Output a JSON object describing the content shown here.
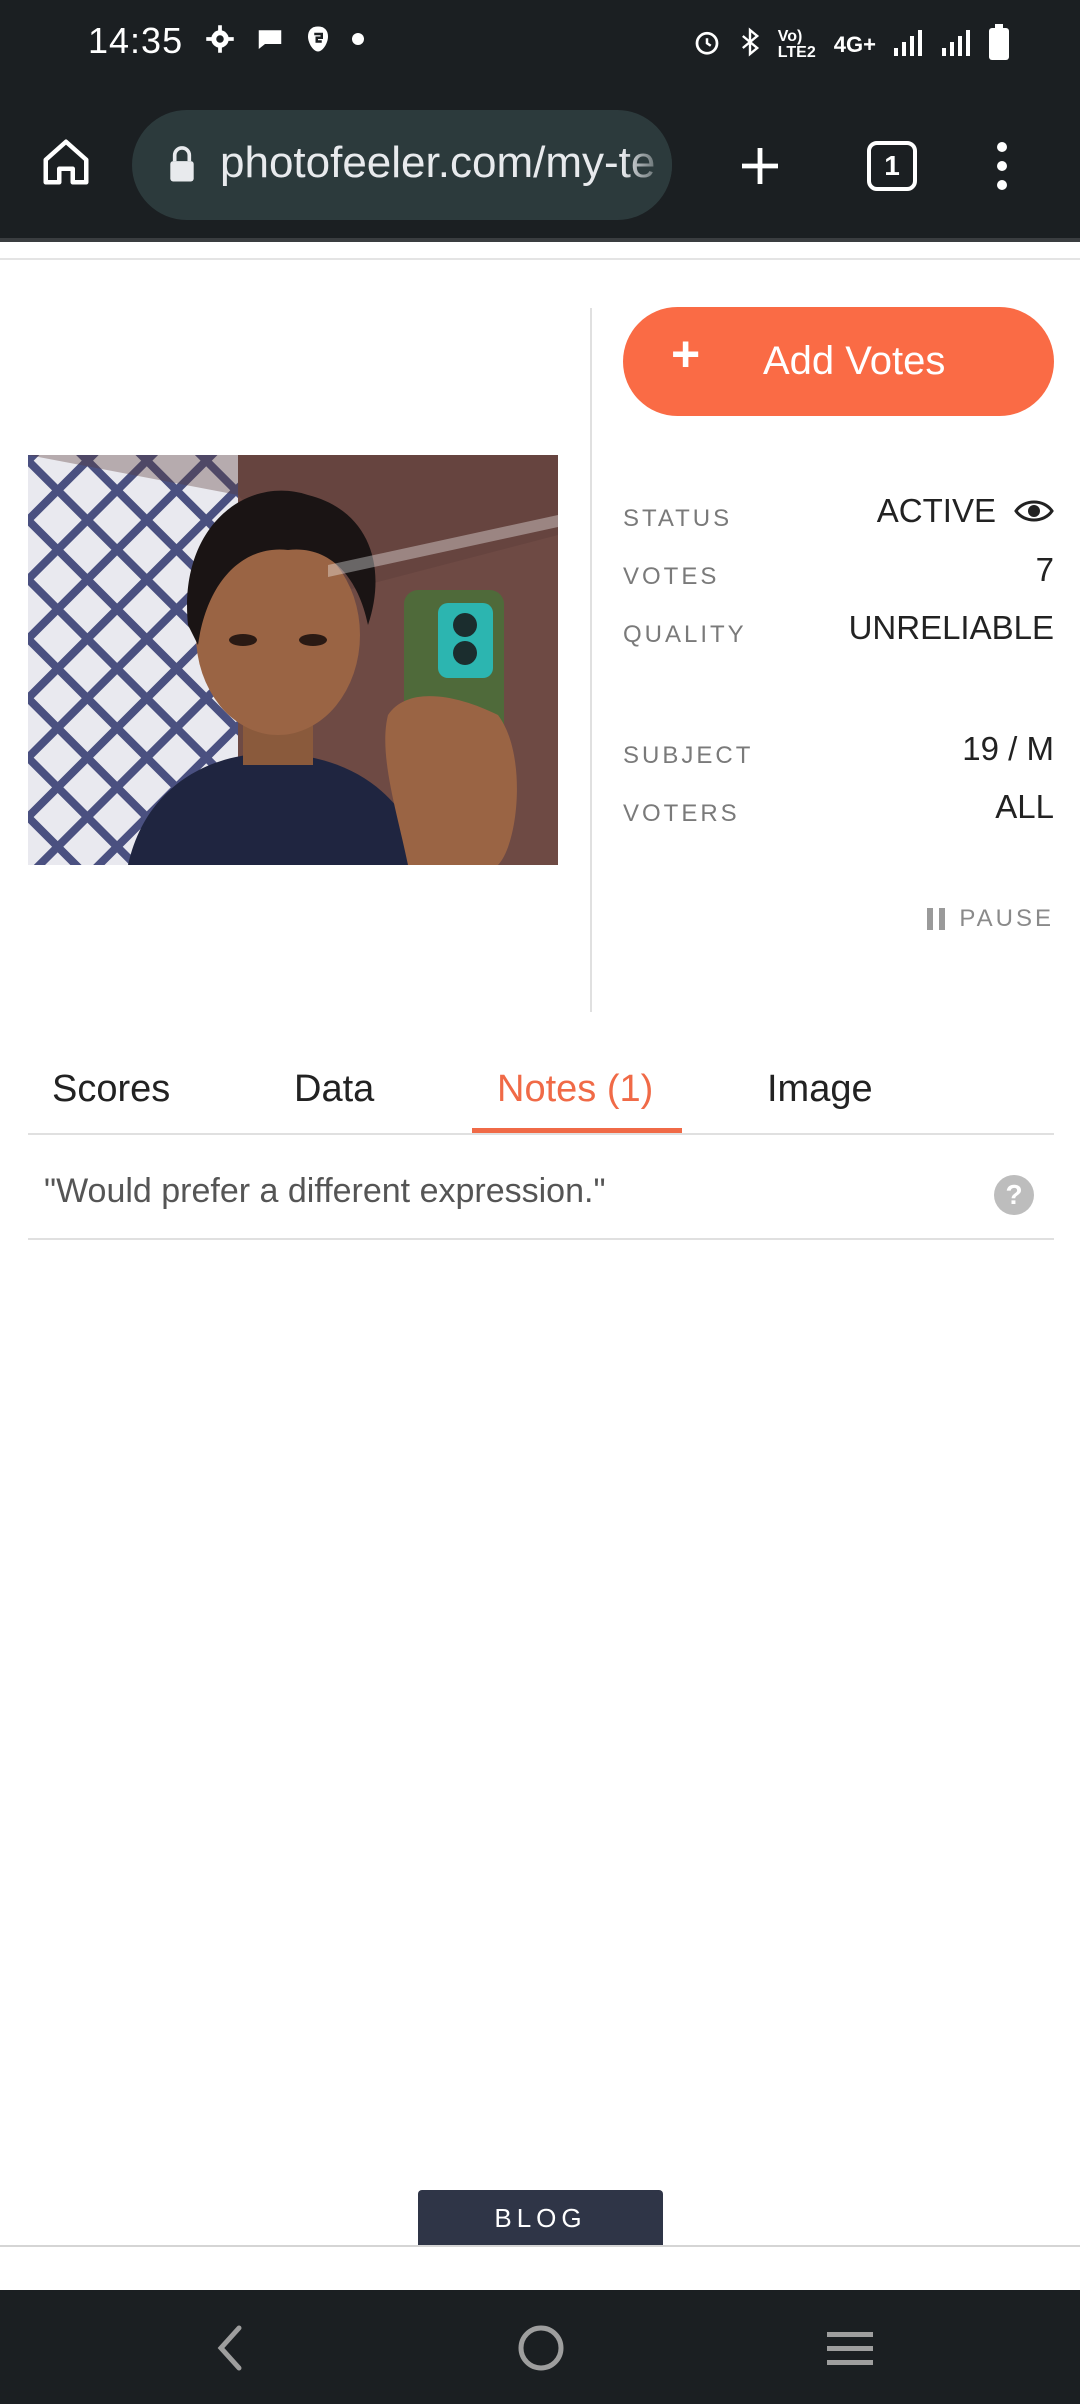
{
  "status_bar": {
    "time": "14:35",
    "left_icons": [
      "gear-icon",
      "chat-icon",
      "app-icon",
      "dot-icon"
    ],
    "right_icons": [
      "alarm-icon",
      "bluetooth-icon",
      "volte-icon",
      "network-4g-icon",
      "signal-icon",
      "signal-icon",
      "battery-icon"
    ],
    "volte_text": "Vo) LTE2",
    "network_text": "4G+"
  },
  "browser": {
    "url": "photofeeler.com/my-te",
    "tab_count": "1"
  },
  "test": {
    "add_votes_plus": "+",
    "add_votes_label": "Add Votes",
    "stats": [
      {
        "label": "STATUS",
        "value": "ACTIVE"
      },
      {
        "label": "VOTES",
        "value": "7"
      },
      {
        "label": "QUALITY",
        "value": "UNRELIABLE"
      },
      {
        "label": "SUBJECT",
        "value": "19 / M"
      },
      {
        "label": "VOTERS",
        "value": "ALL"
      }
    ],
    "pause_label": "PAUSE"
  },
  "tabs": [
    {
      "label": "Scores"
    },
    {
      "label": "Data"
    },
    {
      "label": "Notes (1)",
      "active": true
    },
    {
      "label": "Image"
    }
  ],
  "notes": [
    {
      "text": "\"Would prefer a different expression.\"",
      "help": "?"
    }
  ],
  "blog_label": "BLOG",
  "colors": {
    "accent": "#fa6b45",
    "tab_active": "#f06a47",
    "dark_bar": "#1b1f22",
    "blog_bg": "#2f3547"
  }
}
